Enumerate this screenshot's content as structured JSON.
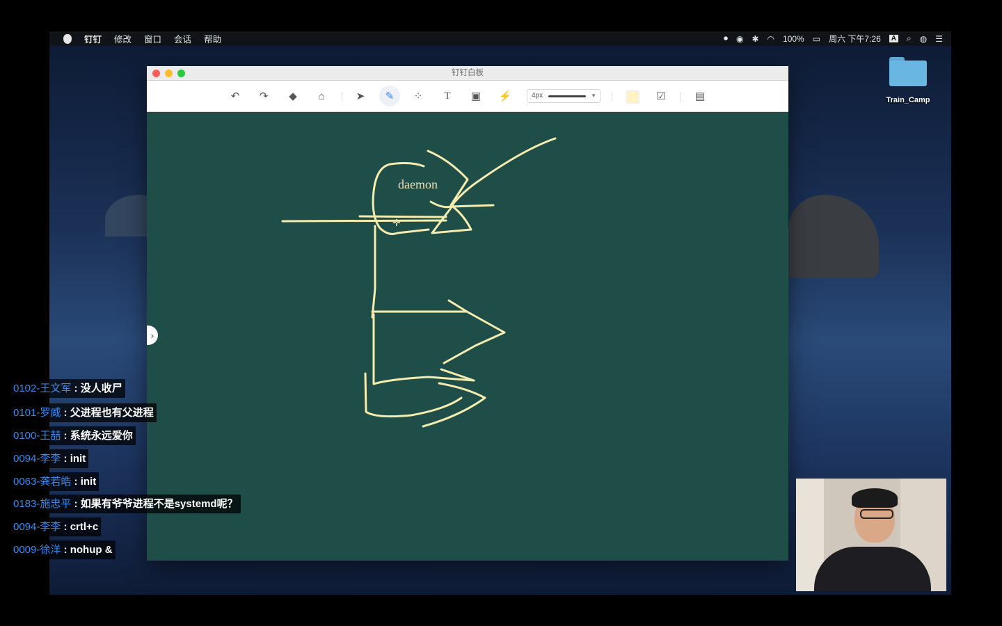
{
  "menubar": {
    "app": "钉钉",
    "items": [
      "修改",
      "窗口",
      "会话",
      "帮助"
    ],
    "battery": "100%",
    "clock": "周六 下午7:26",
    "input_method": "A"
  },
  "desktop": {
    "folder_label": "Train_Camp"
  },
  "window": {
    "title": "钉钉白板",
    "toolbar": {
      "pen_size": "4px",
      "active_tool": "pen",
      "color": "#fff3c4"
    },
    "canvas": {
      "background": "#1f4d48",
      "stroke_color": "#f5ecb0",
      "text_label": "daemon"
    }
  },
  "chat": [
    {
      "user": "0102-王文军",
      "msg": "没人收尸"
    },
    {
      "user": "0101-罗威",
      "msg": "父进程也有父进程"
    },
    {
      "user": "0100-王喆",
      "msg": "系统永远爱你"
    },
    {
      "user": "0094-李李",
      "msg": "init"
    },
    {
      "user": "0063-龚若皓",
      "msg": "init"
    },
    {
      "user": "0183-施忠平",
      "msg": "如果有爷爷进程不是systemd呢？"
    },
    {
      "user": "0094-李李",
      "msg": "crtl+c"
    },
    {
      "user": "0009-徐洋",
      "msg": "nohup &"
    }
  ]
}
